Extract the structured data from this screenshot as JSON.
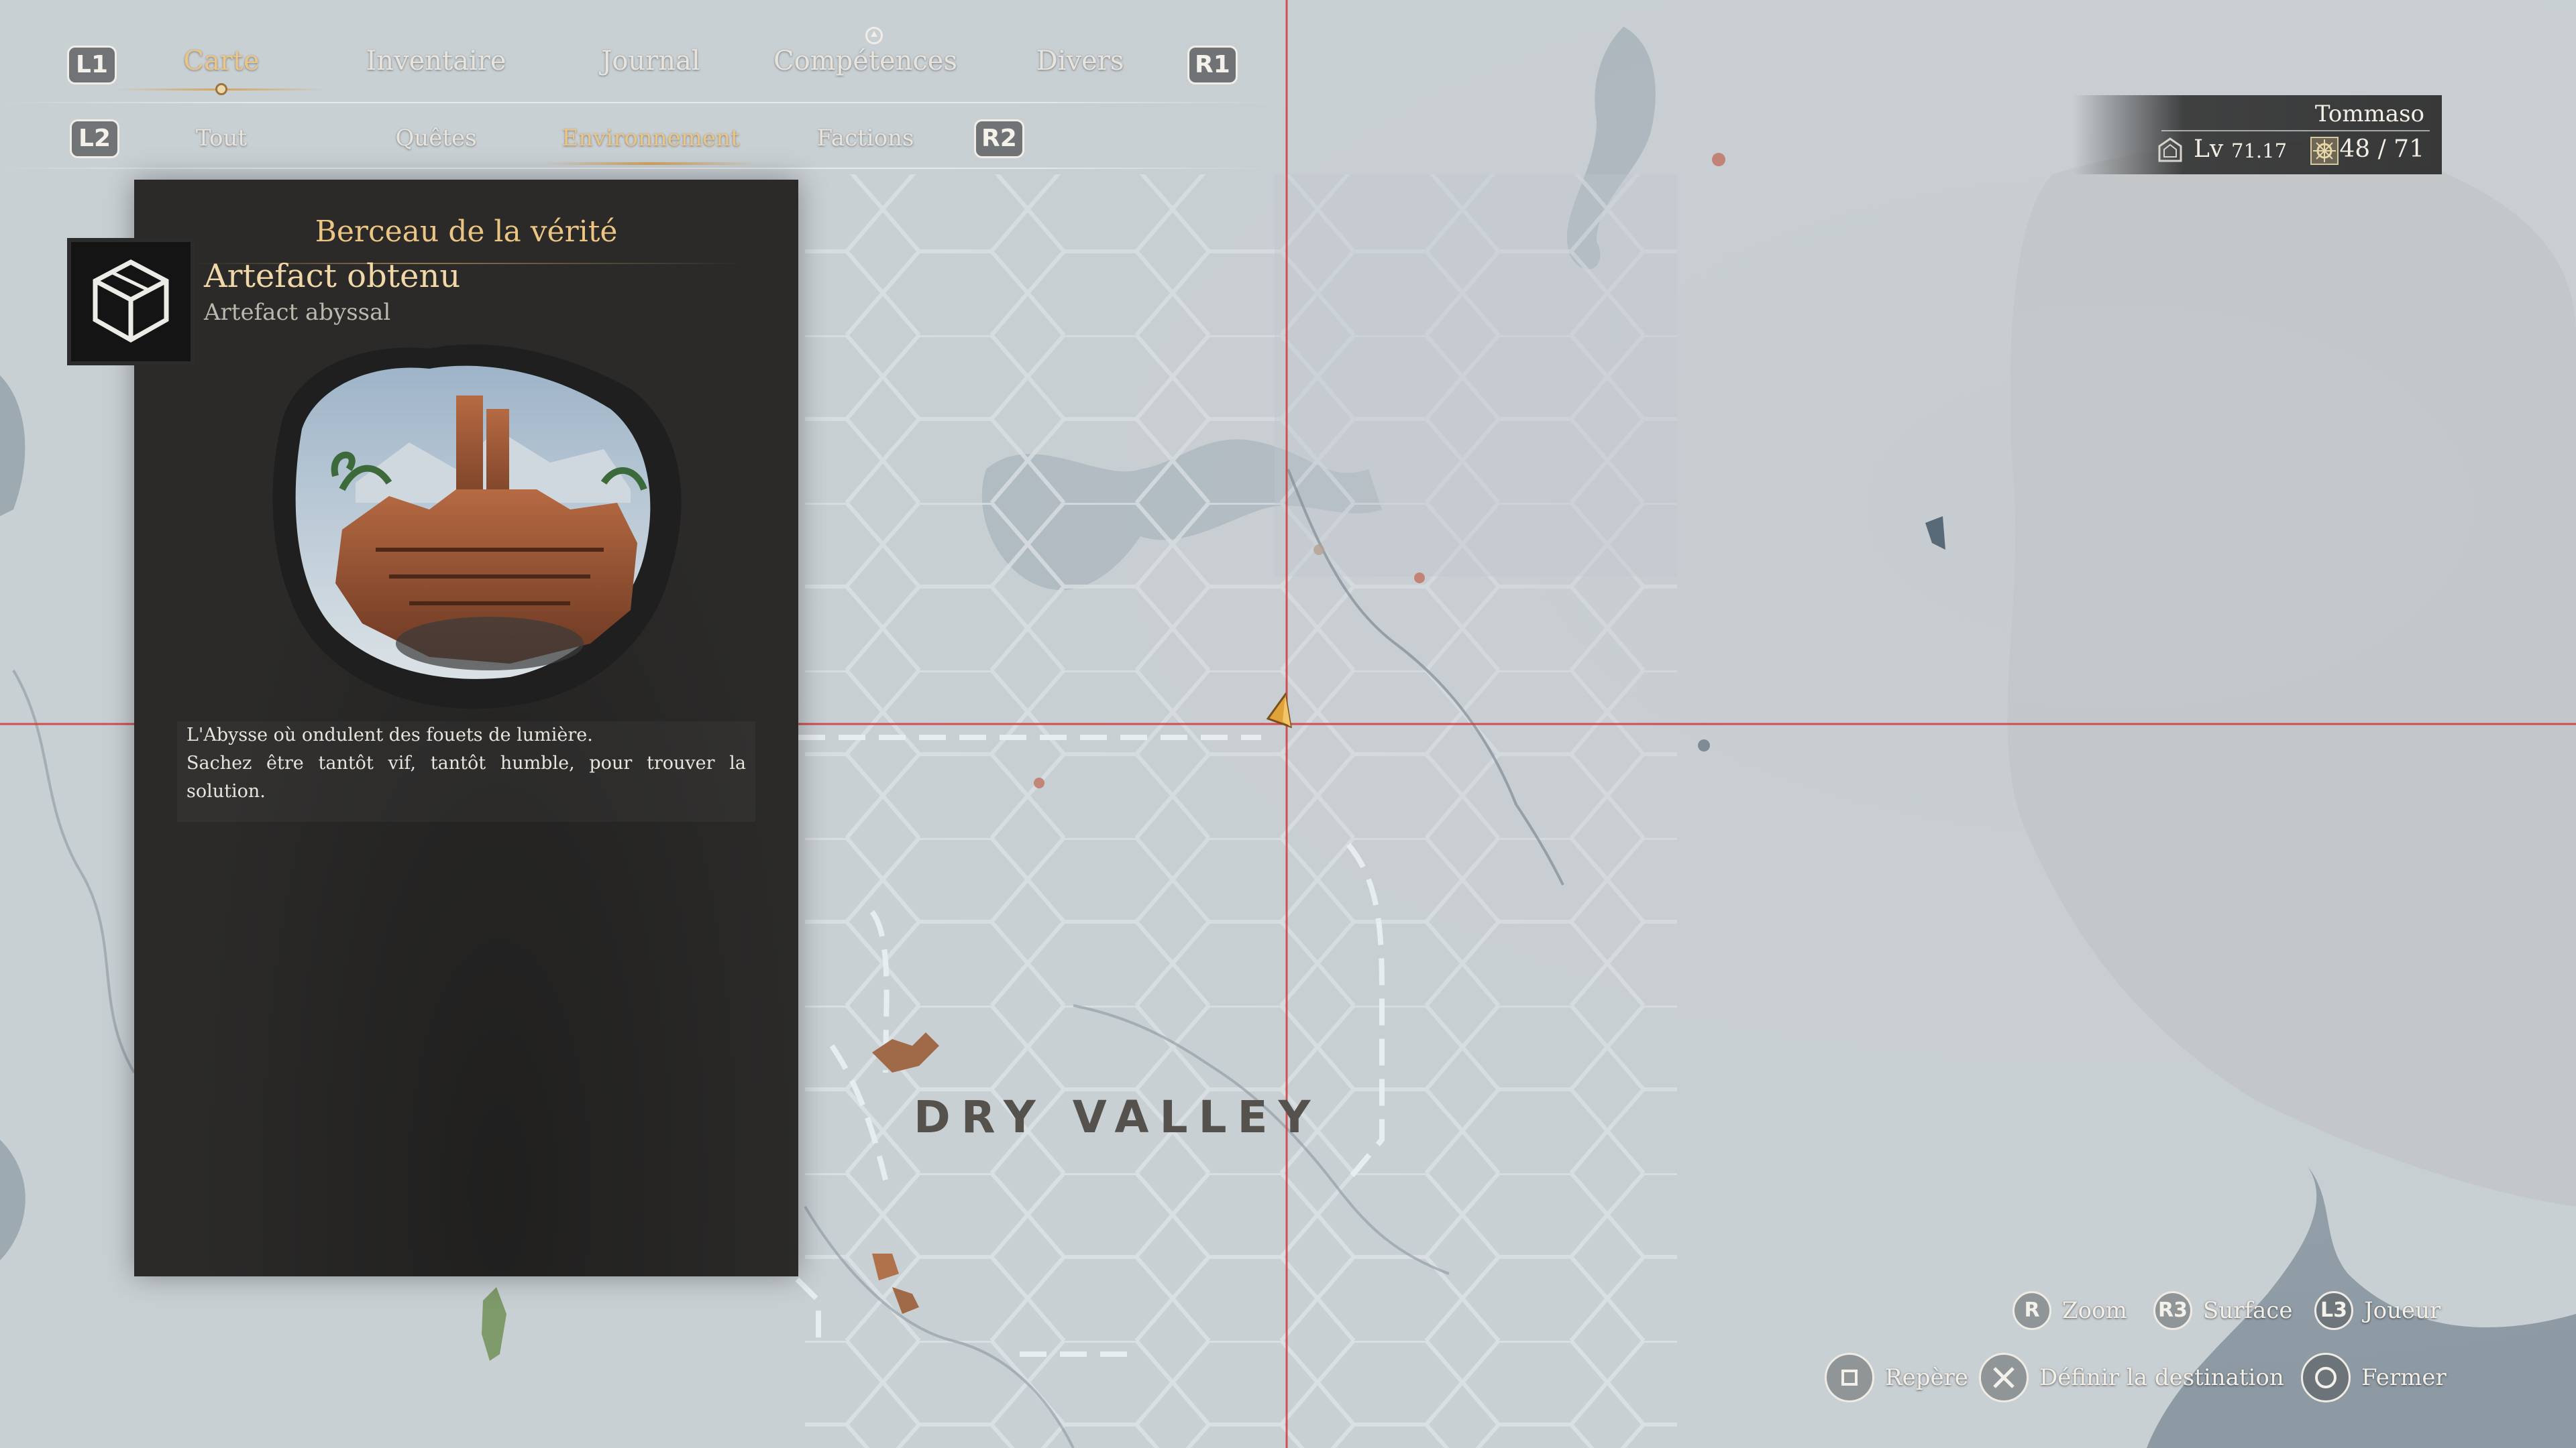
{
  "nav": {
    "l1": "L1",
    "r1": "R1",
    "l2": "L2",
    "r2": "R2",
    "tabs": [
      {
        "label": "Carte"
      },
      {
        "label": "Inventaire"
      },
      {
        "label": "Journal"
      },
      {
        "label": "Compétences"
      },
      {
        "label": "Divers"
      }
    ],
    "active_tab": "Carte",
    "sub_tabs": [
      {
        "label": "Tout"
      },
      {
        "label": "Quêtes"
      },
      {
        "label": "Environnement"
      },
      {
        "label": "Factions"
      }
    ],
    "active_sub_tab": "Environnement"
  },
  "player": {
    "name": "Tommaso",
    "level_label": "Lv",
    "level_value": "71.17",
    "skill_points": "48  /  71"
  },
  "panel": {
    "title": "Berceau de la vérité",
    "status": "Artefact obtenu",
    "type": "Artefact abyssal",
    "description_lines": [
      "L'Abysse où ondulent des fouets de lumière.",
      "Sachez être tantôt vif, tantôt humble, pour trouver la",
      "solution."
    ]
  },
  "map": {
    "region_label": "DRY VALLEY"
  },
  "controls": {
    "zoom": {
      "key": "R",
      "label": "Zoom"
    },
    "surface": {
      "key": "R3",
      "label": "Surface"
    },
    "joueur": {
      "key": "L3",
      "label": "Joueur"
    },
    "repere": {
      "label": "Repère"
    },
    "destination": {
      "label": "Définir la destination"
    },
    "fermer": {
      "label": "Fermer"
    }
  },
  "colors": {
    "accent_gold": "#ecc583",
    "crosshair": "#d23a3a",
    "panel_bg": "#2b2a29",
    "map_bg": "#c9d0d4"
  }
}
